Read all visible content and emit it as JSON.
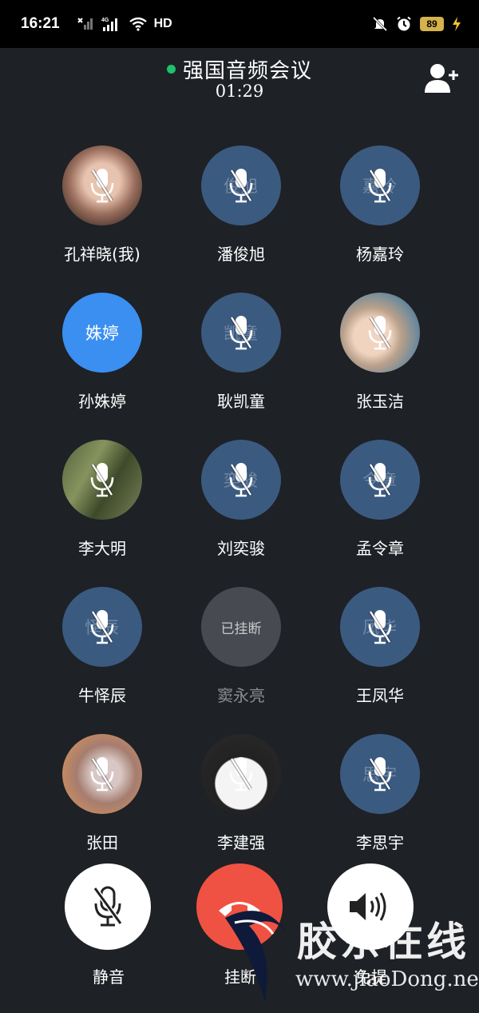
{
  "status_bar": {
    "time": "16:21",
    "network": "4G",
    "hd": "HD",
    "battery": "89",
    "icons": [
      "signal-off-icon",
      "signal-icon",
      "wifi-icon",
      "mute-bell-icon",
      "alarm-icon",
      "battery-icon",
      "charging-icon"
    ]
  },
  "header": {
    "title": "强国音频会议",
    "timer": "01:29",
    "status_color": "#1fc16b"
  },
  "participants": [
    {
      "name": "孔祥晓(我)",
      "avatar_text": "",
      "avatar_type": "photo",
      "muted": true
    },
    {
      "name": "潘俊旭",
      "avatar_text": "俊旭",
      "avatar_type": "initials",
      "muted": true
    },
    {
      "name": "杨嘉玲",
      "avatar_text": "嘉玲",
      "avatar_type": "initials",
      "muted": true
    },
    {
      "name": "孙姝婷",
      "avatar_text": "姝婷",
      "avatar_type": "speaking",
      "muted": false
    },
    {
      "name": "耿凯童",
      "avatar_text": "凯童",
      "avatar_type": "initials",
      "muted": true
    },
    {
      "name": "张玉洁",
      "avatar_text": "",
      "avatar_type": "photo",
      "muted": true
    },
    {
      "name": "李大明",
      "avatar_text": "",
      "avatar_type": "photo",
      "muted": true
    },
    {
      "name": "刘奕骏",
      "avatar_text": "奕骏",
      "avatar_type": "initials",
      "muted": true
    },
    {
      "name": "孟令章",
      "avatar_text": "令章",
      "avatar_type": "initials",
      "muted": true
    },
    {
      "name": "牛怿辰",
      "avatar_text": "怿辰",
      "avatar_type": "initials",
      "muted": true
    },
    {
      "name": "窦永亮",
      "avatar_text": "已挂断",
      "avatar_type": "hung_up",
      "muted": false
    },
    {
      "name": "王凤华",
      "avatar_text": "凤华",
      "avatar_type": "initials",
      "muted": true
    },
    {
      "name": "张田",
      "avatar_text": "",
      "avatar_type": "photo",
      "muted": true
    },
    {
      "name": "李建强",
      "avatar_text": "",
      "avatar_type": "photo",
      "muted": true
    },
    {
      "name": "李思宇",
      "avatar_text": "思宇",
      "avatar_type": "initials",
      "muted": true
    }
  ],
  "controls": {
    "mute_label": "静音",
    "hangup_label": "挂断",
    "speaker_label": "免提",
    "hangup_color": "#ef5242"
  },
  "watermark": {
    "text": "胶东在线",
    "url": "www.jiaoDong.net"
  },
  "colors": {
    "background": "#1e2126",
    "avatar_default": "#3b5a80",
    "avatar_speaking": "#3a8ff0",
    "avatar_hung_up": "#474a50"
  }
}
